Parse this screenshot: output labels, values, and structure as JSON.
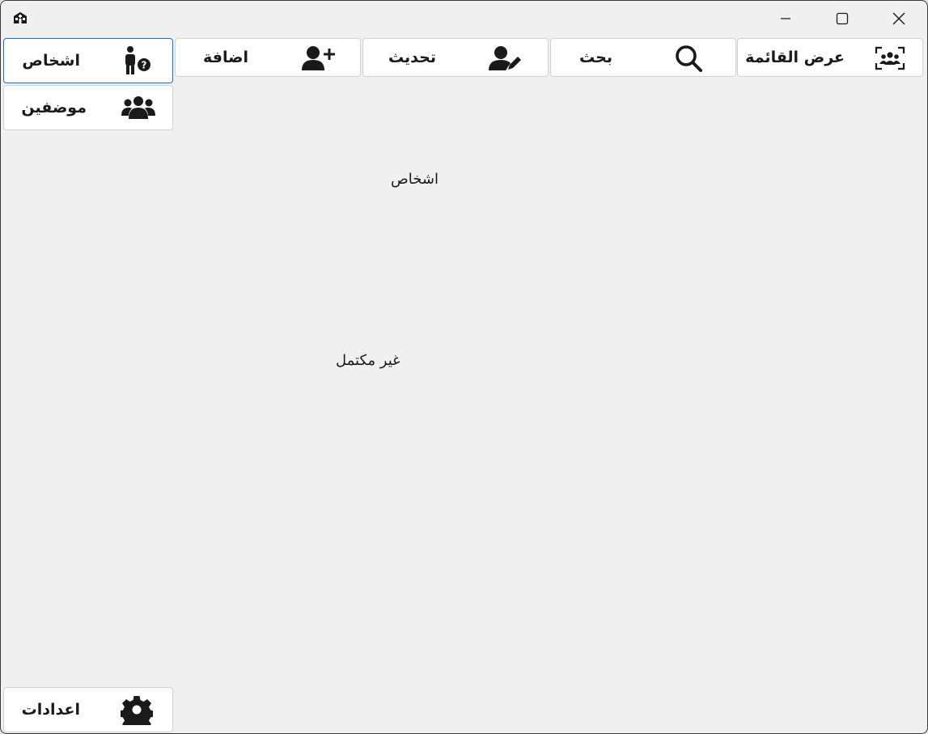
{
  "window": {
    "controls": {
      "minimize": "minimize",
      "maximize": "maximize",
      "close": "close"
    }
  },
  "toolbar": {
    "items": [
      {
        "label": "عرض القائمة",
        "icon": "users-list-icon"
      },
      {
        "label": "بحث",
        "icon": "search-icon"
      },
      {
        "label": "تحديث",
        "icon": "user-edit-icon"
      },
      {
        "label": "اضافة",
        "icon": "user-plus-icon"
      }
    ]
  },
  "sidebar": {
    "items": [
      {
        "label": "اشخاص",
        "icon": "person-question-icon",
        "selected": true
      },
      {
        "label": "موضفين",
        "icon": "users-group-icon",
        "selected": false
      }
    ],
    "settings": {
      "label": "اعدادات",
      "icon": "gear-icon"
    }
  },
  "main": {
    "heading": "اشخاص",
    "status": "غير مكتمل"
  },
  "colors": {
    "window_bg": "#f0f0f0",
    "button_bg": "#fdfdfd",
    "selected_border": "#1b6fc4",
    "text": "#1a1a1a"
  }
}
